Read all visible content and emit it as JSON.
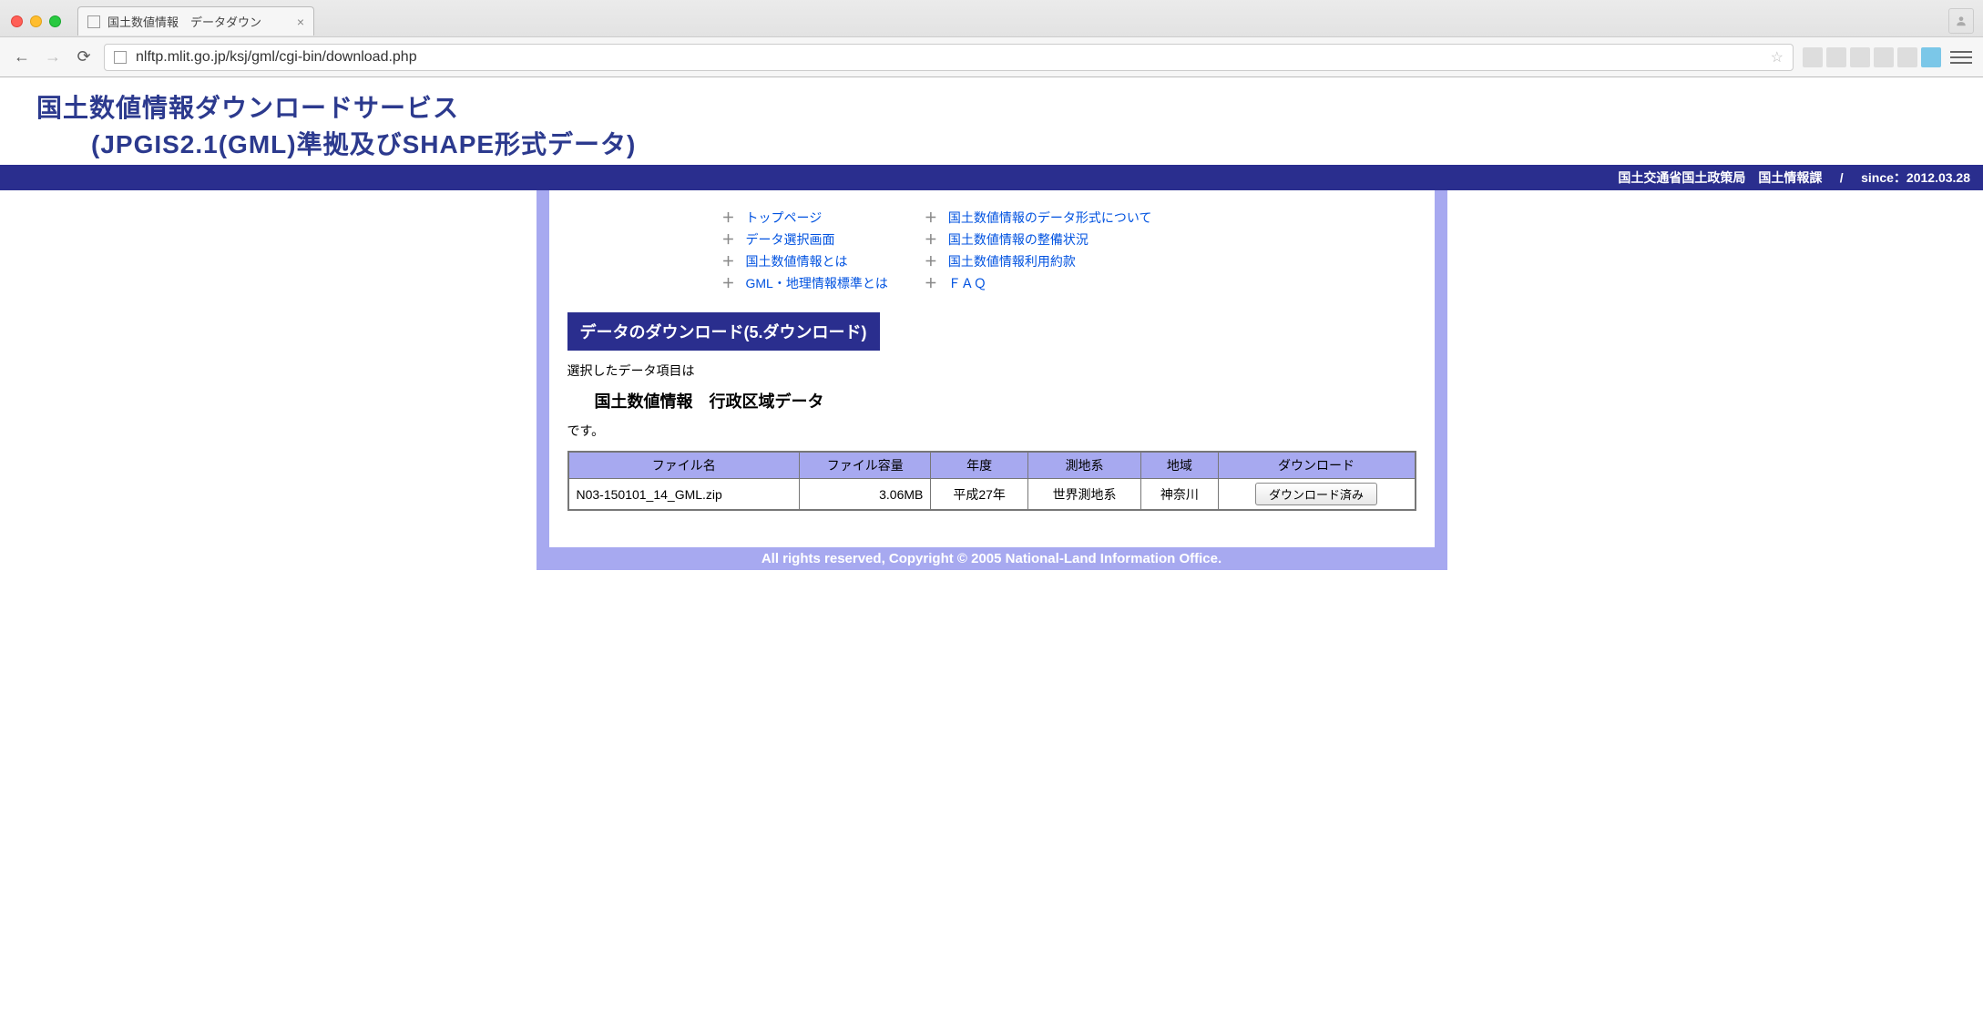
{
  "browser": {
    "tab_title": "国土数値情報　データダウン",
    "url": "nlftp.mlit.go.jp/ksj/gml/cgi-bin/download.php"
  },
  "header": {
    "title_line1": "国土数値情報ダウンロードサービス",
    "title_line2": "(JPGIS2.1(GML)準拠及びSHAPE形式データ)"
  },
  "meta_bar": {
    "org": "国土交通省国土政策局　国土情報課",
    "sep": "/",
    "since": "since：2012.03.28"
  },
  "nav": {
    "col1": [
      "トップページ",
      "データ選択画面",
      "国土数値情報とは",
      "GML・地理情報標準とは"
    ],
    "col2": [
      "国土数値情報のデータ形式について",
      "国土数値情報の整備状況",
      "国土数値情報利用約款",
      "ＦＡＱ"
    ]
  },
  "section": {
    "title": "データのダウンロード(5.ダウンロード)",
    "intro_prefix": "選択したデータ項目は",
    "data_name": "国土数値情報　行政区域データ",
    "intro_suffix": "です。"
  },
  "table": {
    "headers": [
      "ファイル名",
      "ファイル容量",
      "年度",
      "測地系",
      "地域",
      "ダウンロード"
    ],
    "row": {
      "filename": "N03-150101_14_GML.zip",
      "size": "3.06MB",
      "year": "平成27年",
      "datum": "世界測地系",
      "region": "神奈川",
      "button": "ダウンロード済み"
    }
  },
  "footer": {
    "copyright": "All rights reserved, Copyright © 2005 National-Land Information Office."
  }
}
